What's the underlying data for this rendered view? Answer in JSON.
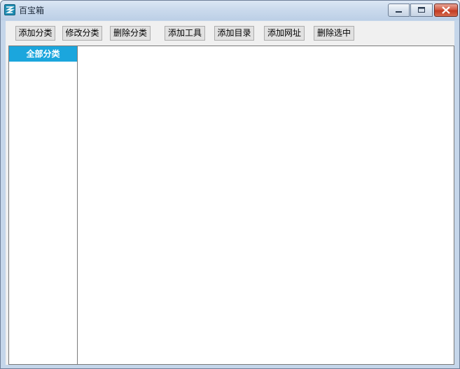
{
  "window": {
    "title": "百宝箱"
  },
  "toolbar": {
    "buttons": [
      {
        "label": "添加分类"
      },
      {
        "label": "修改分类"
      },
      {
        "label": "删除分类"
      },
      {
        "label": "添加工具"
      },
      {
        "label": "添加目录"
      },
      {
        "label": "添加网址"
      },
      {
        "label": "删除选中"
      }
    ]
  },
  "sidebar": {
    "items": [
      {
        "label": "全部分类",
        "selected": true
      }
    ]
  },
  "colors": {
    "selected_item_bg": "#1ba6dd",
    "close_button": "#c94a30"
  }
}
